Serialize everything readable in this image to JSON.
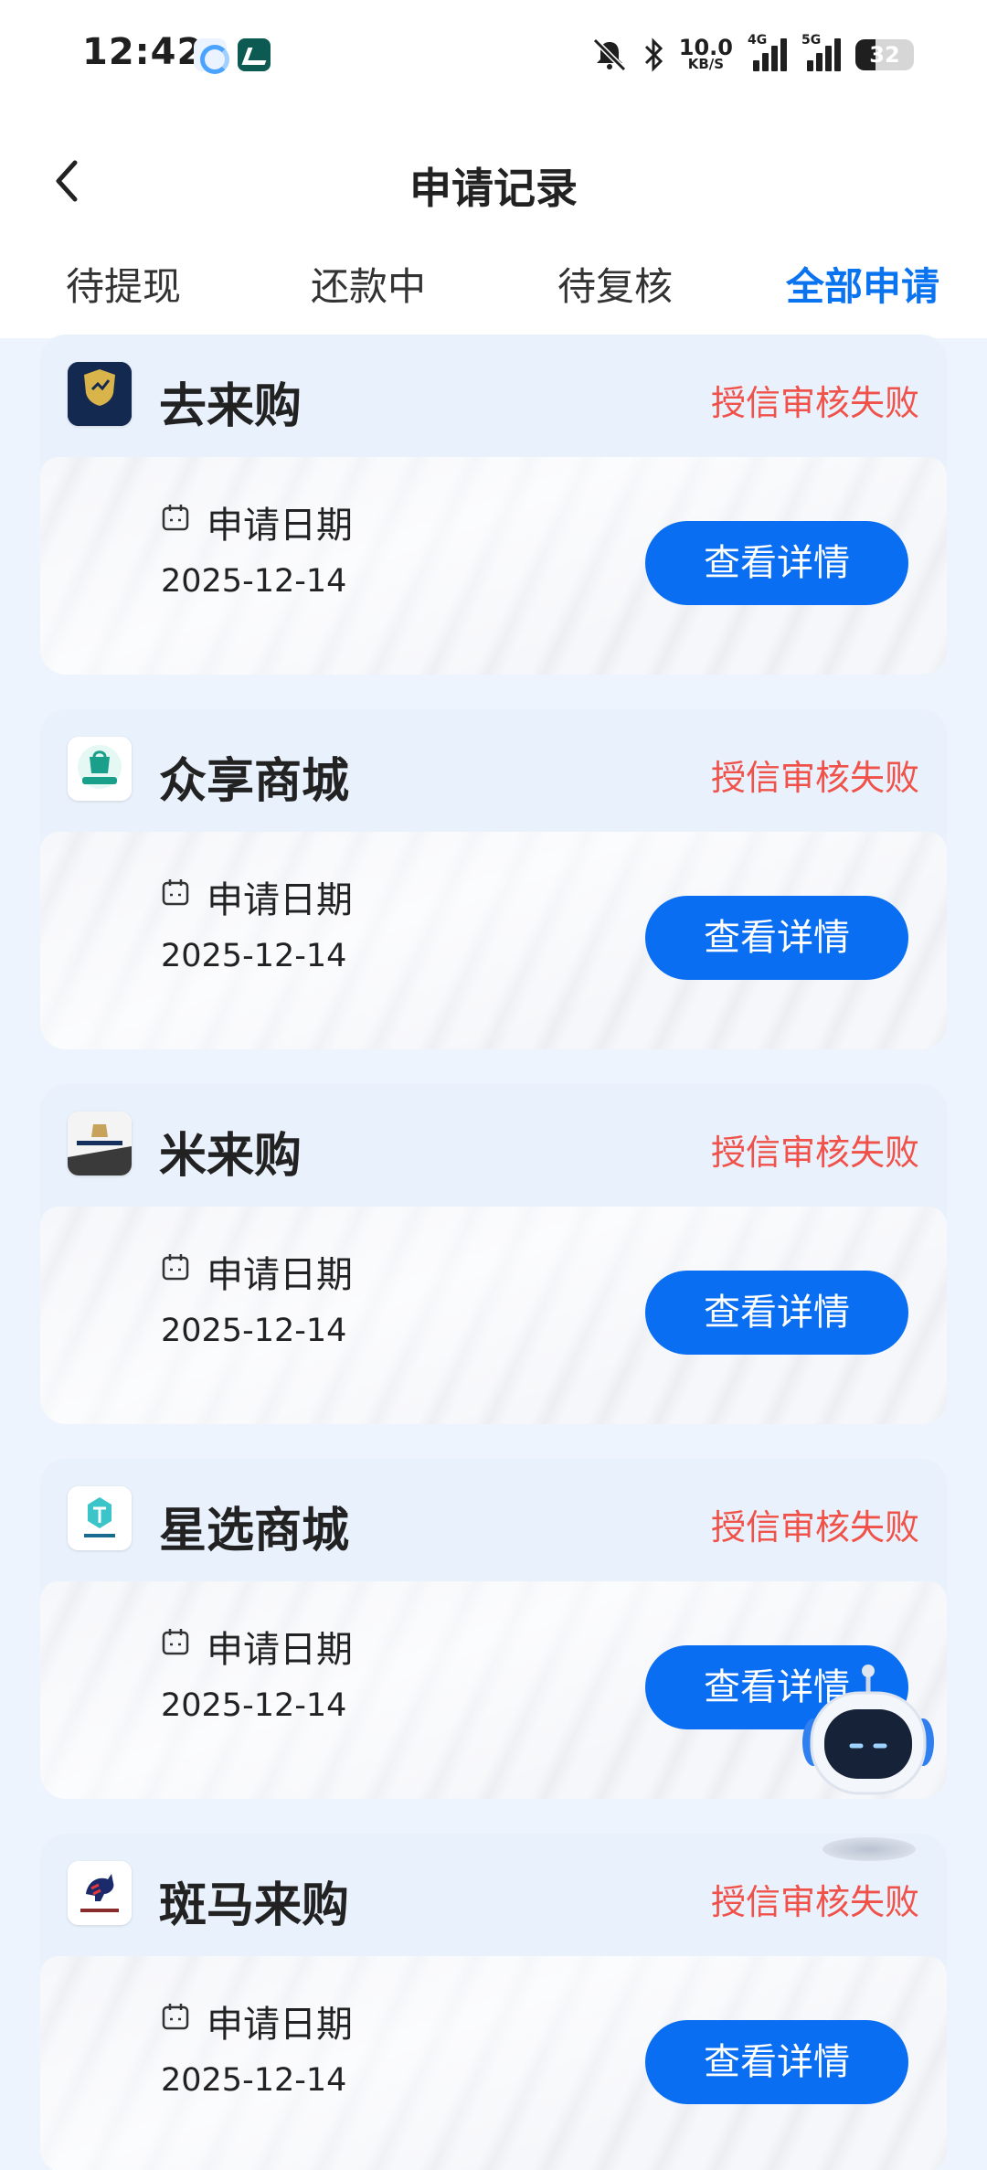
{
  "status_bar": {
    "time": "12:42",
    "net_speed_value": "10.0",
    "net_speed_unit": "KB/S",
    "signal1_label": "4G",
    "signal2_label": "5G",
    "battery": "32"
  },
  "header": {
    "title": "申请记录",
    "back_icon": "chevron-left-icon"
  },
  "tabs": [
    {
      "label": "待提现",
      "active": false
    },
    {
      "label": "还款中",
      "active": false
    },
    {
      "label": "待复核",
      "active": false
    },
    {
      "label": "全部申请",
      "active": true
    }
  ],
  "colors": {
    "accent": "#0a74f0",
    "status_fail": "#f0524a",
    "background": "#eef4fd"
  },
  "records": [
    {
      "name": "去来购",
      "logo_text": "去来购",
      "status": "授信审核失败",
      "date_label": "申请日期",
      "date": "2025-12-14",
      "button": "查看详情"
    },
    {
      "name": "众享商城",
      "logo_text": "众享商城",
      "status": "授信审核失败",
      "date_label": "申请日期",
      "date": "2025-12-14",
      "button": "查看详情"
    },
    {
      "name": "米来购",
      "logo_text": "米来购",
      "status": "授信审核失败",
      "date_label": "申请日期",
      "date": "2025-12-14",
      "button": "查看详情"
    },
    {
      "name": "星选商城",
      "logo_text": "星选商城",
      "status": "授信审核失败",
      "date_label": "申请日期",
      "date": "2025-12-14",
      "button": "查看详情"
    },
    {
      "name": "斑马来购",
      "logo_text": "斑马来购",
      "status": "授信审核失败",
      "date_label": "申请日期",
      "date": "2025-12-14",
      "button": "查看详情"
    }
  ],
  "floating_assistant": {
    "icon": "robot-assistant-icon"
  }
}
